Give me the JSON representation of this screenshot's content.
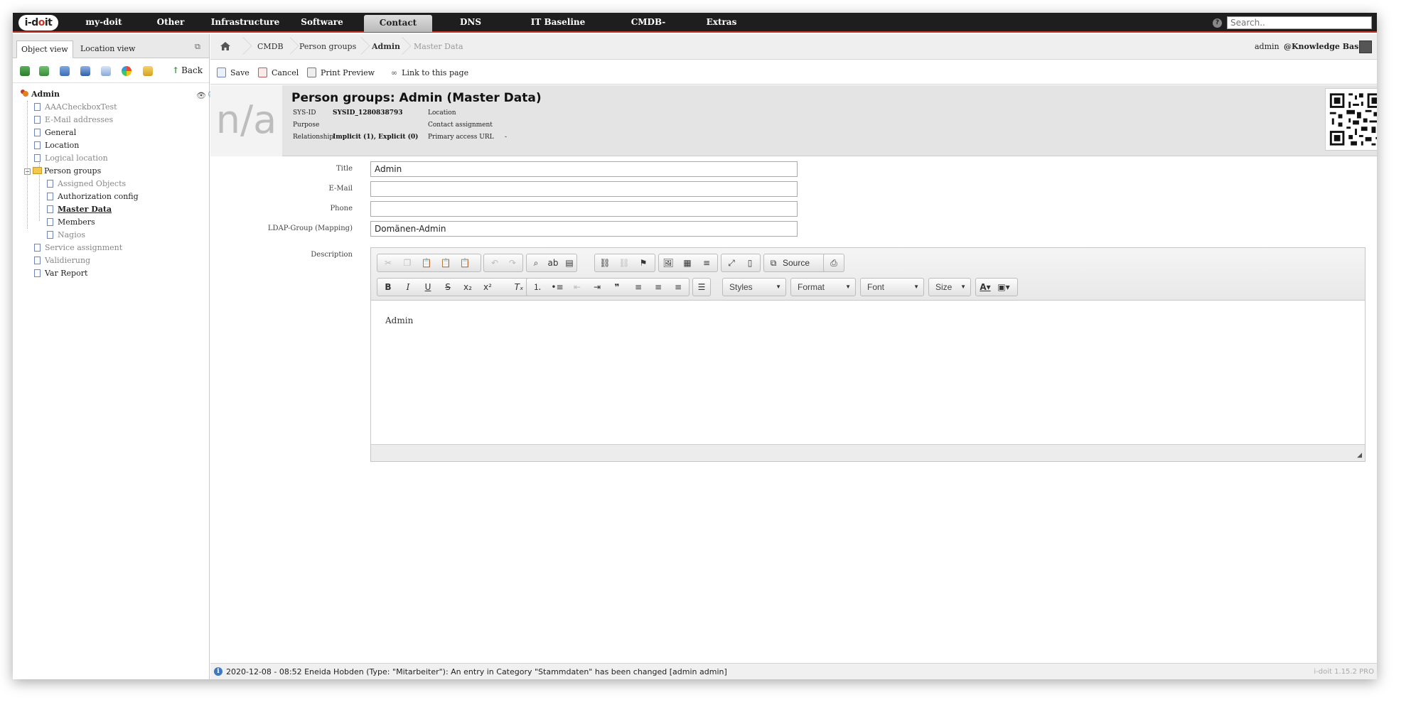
{
  "topnav": {
    "logo_prefix": "i-d",
    "logo_o": "o",
    "logo_suffix": "it",
    "items": [
      "my-doit",
      "Other",
      "Infrastructure",
      "Software",
      "Contact",
      "DNS",
      "IT Baseline Protection",
      "CMDB-Explorer",
      "Extras"
    ],
    "active_item": "Contact",
    "search_placeholder": "Search.."
  },
  "left_panel": {
    "tabs": [
      "Object view",
      "Location view"
    ],
    "active_tab": "Object view",
    "back_label": "Back",
    "tree": {
      "root": "Admin",
      "items": [
        {
          "label": "AAACheckboxTest",
          "state": "muted"
        },
        {
          "label": "E-Mail addresses",
          "state": "muted"
        },
        {
          "label": "General",
          "state": "normal"
        },
        {
          "label": "Location",
          "state": "normal"
        },
        {
          "label": "Logical location",
          "state": "muted"
        },
        {
          "label": "Person groups",
          "state": "folder"
        },
        {
          "label": "Assigned Objects",
          "state": "muted"
        },
        {
          "label": "Authorization config",
          "state": "normal"
        },
        {
          "label": "Master Data",
          "state": "current"
        },
        {
          "label": "Members",
          "state": "normal"
        },
        {
          "label": "Nagios",
          "state": "muted"
        },
        {
          "label": "Service assignment",
          "state": "muted"
        },
        {
          "label": "Validierung",
          "state": "muted"
        },
        {
          "label": "Var Report",
          "state": "normal"
        }
      ]
    }
  },
  "breadcrumb": {
    "items": [
      "CMDB",
      "Person groups",
      "Admin",
      "Master Data"
    ],
    "user": "admin",
    "tenant": "@Knowledge Base"
  },
  "actions": {
    "save": "Save",
    "cancel": "Cancel",
    "print_preview": "Print Preview",
    "link": "Link to this page"
  },
  "header": {
    "placeholder_image_text": "n/a",
    "title": "Person groups: Admin (Master Data)",
    "sys_id_label": "SYS-ID",
    "sys_id_value": "SYSID_1280838793",
    "purpose_label": "Purpose",
    "relationship_label": "Relationship",
    "relationship_value": "Implicit (1), Explicit (0)",
    "location_label": "Location",
    "contact_label": "Contact assignment",
    "primary_url_label": "Primary access URL",
    "primary_url_value": "-"
  },
  "form": {
    "title_label": "Title",
    "title_value": "Admin",
    "email_label": "E-Mail",
    "email_value": "",
    "phone_label": "Phone",
    "phone_value": "",
    "ldap_label": "LDAP-Group (Mapping)",
    "ldap_value": "Domänen-Admin",
    "description_label": "Description",
    "description_value": "Admin",
    "editor": {
      "source_label": "Source",
      "styles_label": "Styles",
      "format_label": "Format",
      "font_label": "Font",
      "size_label": "Size"
    }
  },
  "status": {
    "message": "2020-12-08 - 08:52 Eneida Hobden (Type: \"Mitarbeiter\"): An entry in Category \"Stammdaten\" has been changed [admin admin]",
    "version": "i-doit 1.15.2 PRO"
  },
  "colors": {
    "nav_bg": "#1e1e1e",
    "nav_accent": "#c0392b",
    "header_bg": "#e4e4e4"
  }
}
